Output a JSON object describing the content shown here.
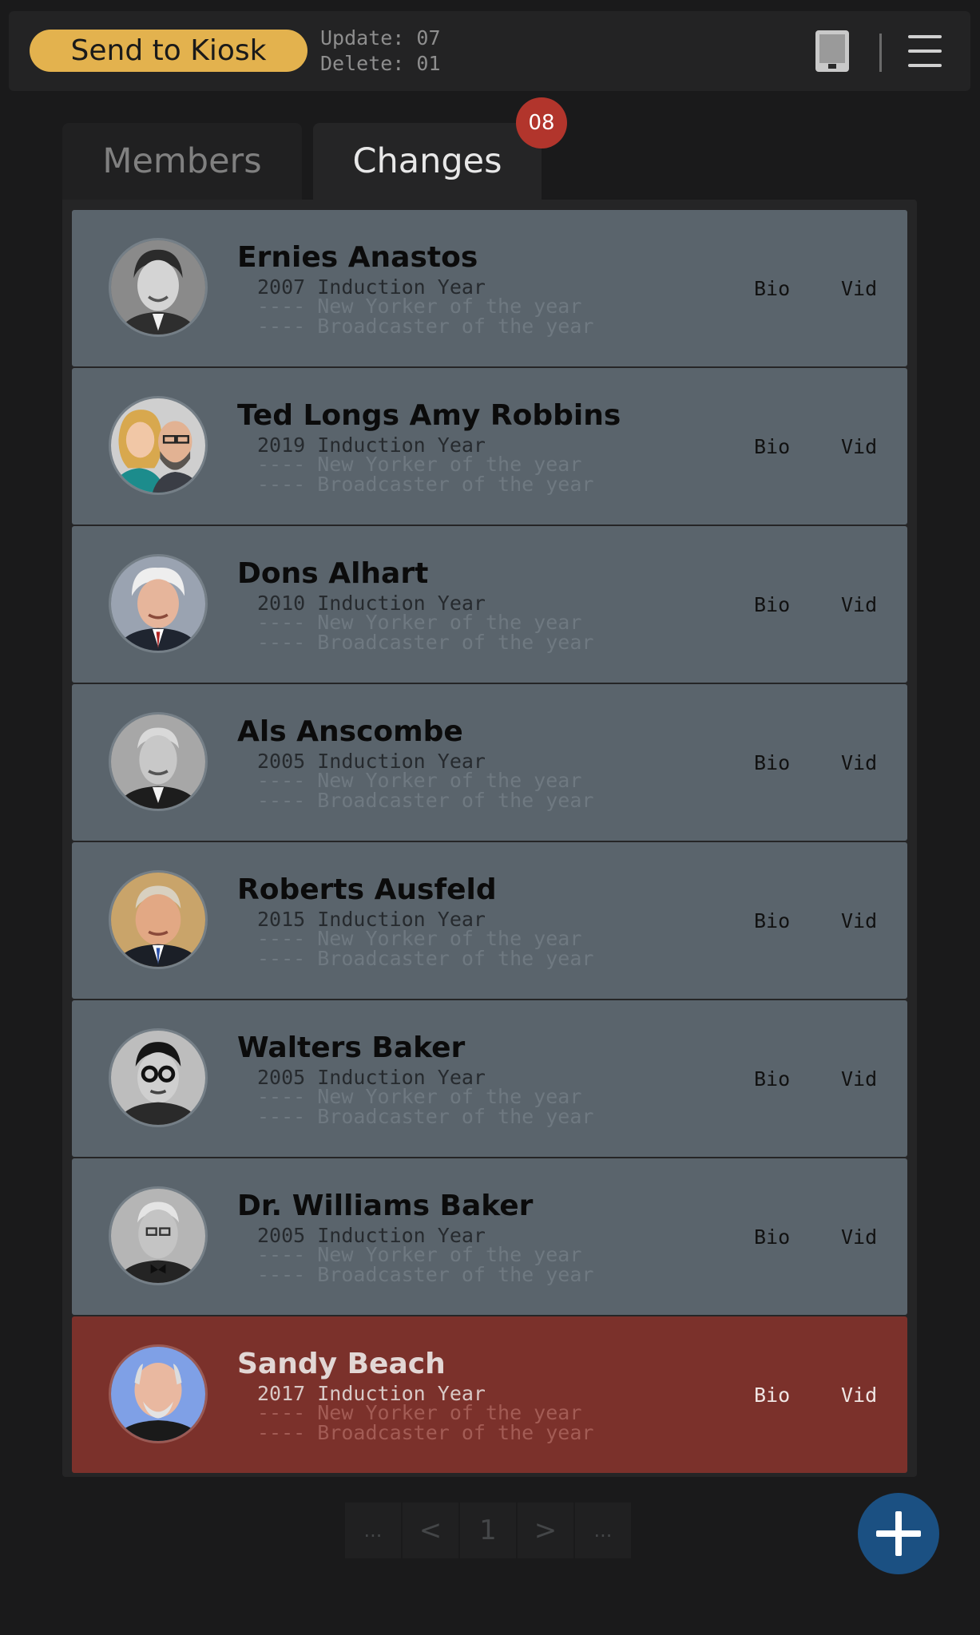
{
  "header": {
    "send_button": "Send to Kiosk",
    "update_line": "Update: 07",
    "delete_line": "Delete: 01",
    "icons": [
      "tablet-icon",
      "menu-icon"
    ]
  },
  "tabs": [
    {
      "label": "Members",
      "active": false
    },
    {
      "label": "Changes",
      "active": true,
      "badge": "08"
    }
  ],
  "colors": {
    "accent_button": "#e3b24e",
    "row_background": "#5a646c",
    "row_highlight": "#7b312b",
    "badge": "#b2352c",
    "fab": "#1b5082"
  },
  "members": [
    {
      "name": "Ernies Anastos",
      "year_line": "2007 Induction Year",
      "award1": "---- New Yorker of the year",
      "award2": "---- Broadcaster of the year",
      "bio": "Bio",
      "vid": "Vid",
      "highlighted": false
    },
    {
      "name": "Ted Longs Amy Robbins",
      "year_line": "2019 Induction Year",
      "award1": "---- New Yorker of the year",
      "award2": "---- Broadcaster of the year",
      "bio": "Bio",
      "vid": "Vid",
      "highlighted": false
    },
    {
      "name": "Dons Alhart",
      "year_line": "2010 Induction Year",
      "award1": "---- New Yorker of the year",
      "award2": "---- Broadcaster of the year",
      "bio": "Bio",
      "vid": "Vid",
      "highlighted": false
    },
    {
      "name": "Als Anscombe",
      "year_line": "2005 Induction Year",
      "award1": "---- New Yorker of the year",
      "award2": "---- Broadcaster of the year",
      "bio": "Bio",
      "vid": "Vid",
      "highlighted": false
    },
    {
      "name": "Roberts Ausfeld",
      "year_line": "2015 Induction Year",
      "award1": "---- New Yorker of the year",
      "award2": "---- Broadcaster of the year",
      "bio": "Bio",
      "vid": "Vid",
      "highlighted": false
    },
    {
      "name": "Walters Baker",
      "year_line": "2005 Induction Year",
      "award1": "---- New Yorker of the year",
      "award2": "---- Broadcaster of the year",
      "bio": "Bio",
      "vid": "Vid",
      "highlighted": false
    },
    {
      "name": "Dr. Williams Baker",
      "year_line": "2005 Induction Year",
      "award1": "---- New Yorker of the year",
      "award2": "---- Broadcaster of the year",
      "bio": "Bio",
      "vid": "Vid",
      "highlighted": false
    },
    {
      "name": "Sandy Beach",
      "year_line": "2017 Induction Year",
      "award1": "---- New Yorker of the year",
      "award2": "---- Broadcaster of the year",
      "bio": "Bio",
      "vid": "Vid",
      "highlighted": true
    }
  ],
  "pagination": {
    "first": "...",
    "prev": "<",
    "current": "1",
    "next": ">",
    "last": "..."
  },
  "fab_icon": "plus-icon"
}
